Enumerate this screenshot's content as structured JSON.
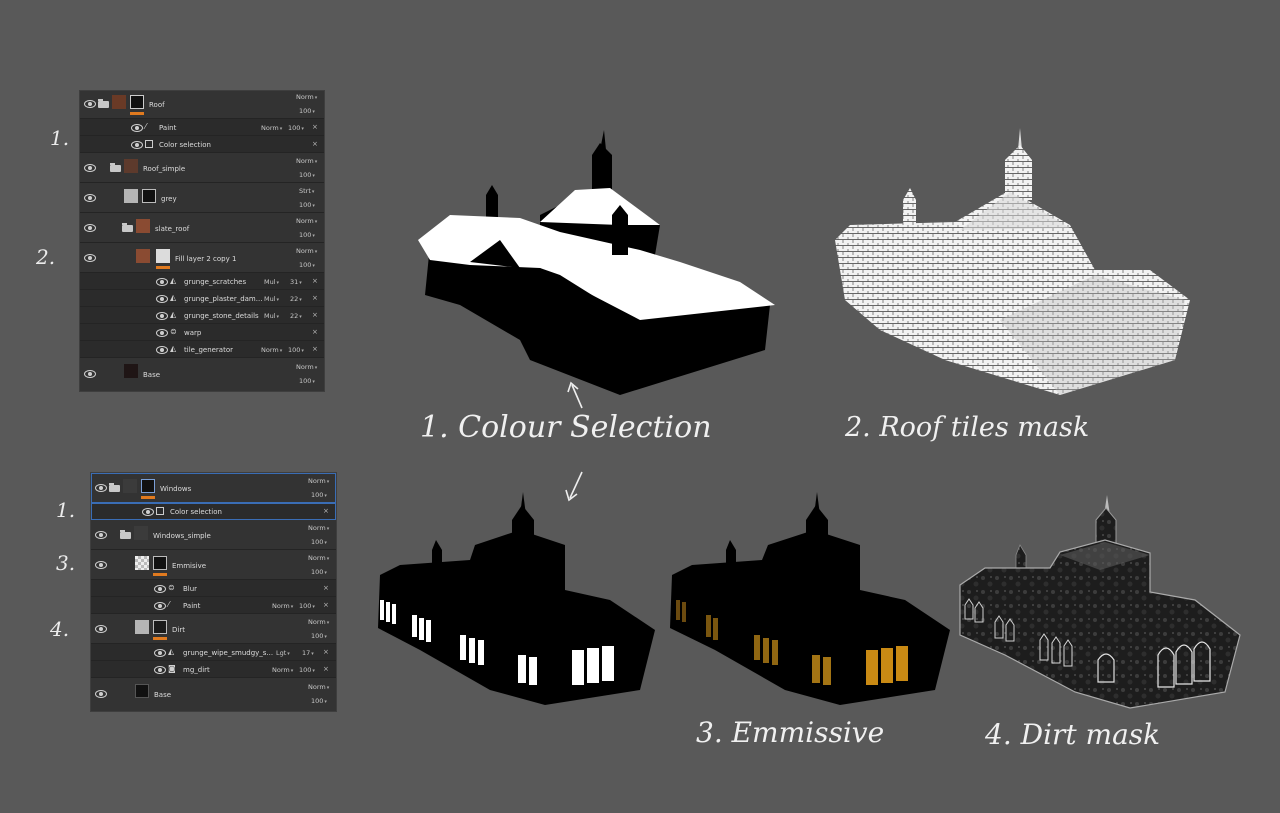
{
  "roof_panel": {
    "layers": [
      {
        "name": "Roof",
        "blend": "Norm",
        "opacity": "100"
      },
      {
        "name": "Paint",
        "blend": "Norm",
        "opacity": "100"
      },
      {
        "name": "Color selection"
      },
      {
        "name": "Roof_simple",
        "blend": "Norm",
        "opacity": "100"
      },
      {
        "name": "grey",
        "blend": "Strt",
        "opacity": "100"
      },
      {
        "name": "slate_roof",
        "blend": "Norm",
        "opacity": "100"
      },
      {
        "name": "Fill layer 2 copy 1",
        "blend": "Norm",
        "opacity": "100"
      },
      {
        "name": "grunge_scratches",
        "blend": "Mul",
        "opacity": "31"
      },
      {
        "name": "grunge_plaster_dam...",
        "blend": "Mul",
        "opacity": "22"
      },
      {
        "name": "grunge_stone_details",
        "blend": "Mul",
        "opacity": "22"
      },
      {
        "name": "warp"
      },
      {
        "name": "tile_generator",
        "blend": "Norm",
        "opacity": "100"
      },
      {
        "name": "Base",
        "blend": "Norm",
        "opacity": "100"
      }
    ]
  },
  "windows_panel": {
    "layers": [
      {
        "name": "Windows",
        "blend": "Norm",
        "opacity": "100"
      },
      {
        "name": "Color selection"
      },
      {
        "name": "Windows_simple",
        "blend": "Norm",
        "opacity": "100"
      },
      {
        "name": "Emmisive",
        "blend": "Norm",
        "opacity": "100"
      },
      {
        "name": "Blur"
      },
      {
        "name": "Paint",
        "blend": "Norm",
        "opacity": "100"
      },
      {
        "name": "Dirt",
        "blend": "Norm",
        "opacity": "100"
      },
      {
        "name": "grunge_wipe_smudgy_s...",
        "blend": "Lgt",
        "opacity": "17"
      },
      {
        "name": "mg_dirt",
        "blend": "Norm",
        "opacity": "100"
      },
      {
        "name": "Base",
        "blend": "Norm",
        "opacity": "100"
      }
    ]
  },
  "annotations": {
    "roof_num_1": "1.",
    "roof_num_2": "2.",
    "win_num_1": "1.",
    "win_num_3": "3.",
    "win_num_4": "4.",
    "cap_colour_selection": "1. Colour Selection",
    "cap_roof_tiles": "2. Roof tiles mask",
    "cap_emmissive": "3. Emmissive",
    "cap_dirt": "4. Dirt mask"
  },
  "colors": {
    "background": "#595959",
    "panel": "#2f2f2f",
    "accent_orange": "#e07a1f",
    "selection_blue": "#3a6db5",
    "emissive_amber": "#c98a14"
  }
}
